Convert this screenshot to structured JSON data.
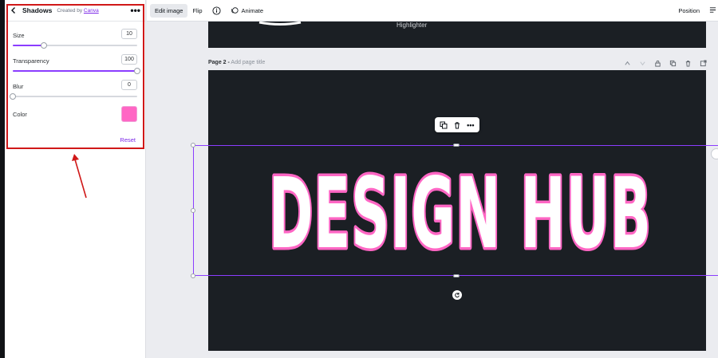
{
  "panel": {
    "title": "Shadows",
    "created_by": "Created by",
    "creator": "Canva",
    "more": "•••",
    "controls": [
      {
        "label": "Size",
        "value": "10",
        "fraction": 0.25
      },
      {
        "label": "Transparency",
        "value": "100",
        "fraction": 1.0
      },
      {
        "label": "Blur",
        "value": "0",
        "fraction": 0.0
      }
    ],
    "color_label": "Color",
    "color_value": "#ff66c4",
    "reset_label": "Reset"
  },
  "toolbar": {
    "edit_image": "Edit image",
    "flip": "Flip",
    "animate": "Animate",
    "position": "Position"
  },
  "page1": {
    "partial_text": "Highlighter"
  },
  "page2": {
    "label_bold": "Page 2 -",
    "label_title": "Add page title",
    "design_text": "DESIGN HUB"
  },
  "context_menu": {
    "more": "•••"
  },
  "colors": {
    "accent": "#8b3dff",
    "link": "#7d2ae8",
    "annotation": "#d01818",
    "canvas_bg": "#1b1f24",
    "text_fill": "#ffffff",
    "text_outline": "#ff66c4"
  }
}
